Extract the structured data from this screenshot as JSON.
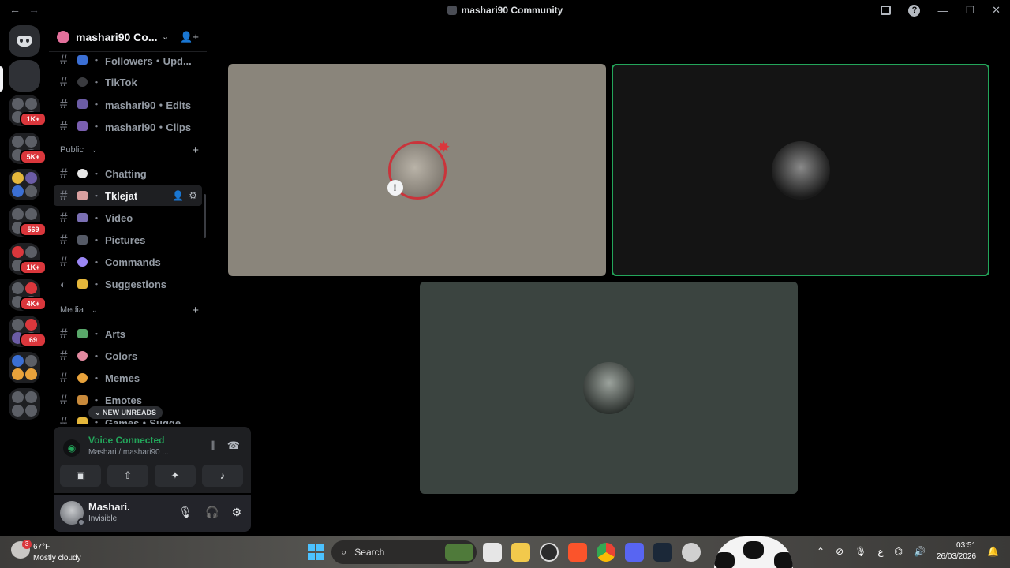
{
  "window": {
    "title": "mashari90 Community",
    "nav_back": "←",
    "nav_forward": "→",
    "controls": [
      "—",
      "☐",
      "✕"
    ]
  },
  "rail": {
    "badges": [
      "1K+",
      "5K+",
      "569",
      "1K+",
      "4K+",
      "69"
    ]
  },
  "server": {
    "name": "mashari90 Co...",
    "chevron": "⌄",
    "invite_icon": "👤+"
  },
  "channels": {
    "top": [
      {
        "name": "Followers・Upd...",
        "emoji_color": "#3b6fd4"
      },
      {
        "name": "TikTok",
        "emoji_color": "#3a3b3f"
      },
      {
        "name": "mashari90・Edits",
        "emoji_color": "#6b5ca5"
      },
      {
        "name": "mashari90・Clips",
        "emoji_color": "#7a5fb0"
      }
    ],
    "categories": [
      {
        "name": "Public",
        "items": [
          {
            "name": "Chatting",
            "emoji_color": "#e8e8e8"
          },
          {
            "name": "Tklejat",
            "emoji_color": "#d9a0a0",
            "active": true
          },
          {
            "name": "Video",
            "emoji_color": "#7a6fb3"
          },
          {
            "name": "Pictures",
            "emoji_color": "#555a66"
          },
          {
            "name": "Commands",
            "emoji_color": "#9b87f5"
          },
          {
            "name": "Suggestions",
            "emoji_color": "#e5b73b"
          }
        ]
      },
      {
        "name": "Media",
        "items": [
          {
            "name": "Arts",
            "emoji_color": "#59a86a"
          },
          {
            "name": "Colors",
            "emoji_color": "#e28aa0"
          },
          {
            "name": "Memes",
            "emoji_color": "#e8a23b"
          },
          {
            "name": "Emotes",
            "emoji_color": "#c98a3b"
          },
          {
            "name": "Games・Suggest...",
            "emoji_color": "#e5b73b"
          }
        ]
      }
    ],
    "new_unreads": "NEW UNREADS",
    "hash": "#",
    "separator": "・",
    "plus": "+"
  },
  "voice": {
    "status": "Voice Connected",
    "channel": "Mashari / mashari90 ...",
    "buttons": [
      "camera-off",
      "screen-share",
      "activities",
      "soundboard"
    ]
  },
  "user": {
    "name": "Mashari.",
    "status": "Invisible"
  },
  "stage": {
    "tiles": [
      {
        "id": "tile-1",
        "speaking": false
      },
      {
        "id": "tile-2",
        "speaking": true
      },
      {
        "id": "tile-3",
        "speaking": false
      }
    ]
  },
  "taskbar": {
    "weather_badge": "3",
    "temperature": "67°F",
    "condition": "Mostly cloudy",
    "search_placeholder": "Search",
    "time": "03:51",
    "date": "26/03/2026",
    "lang": "ع"
  },
  "colors": {
    "accent_green": "#23a55a",
    "badge_red": "#da373c",
    "bg": "#000000"
  }
}
